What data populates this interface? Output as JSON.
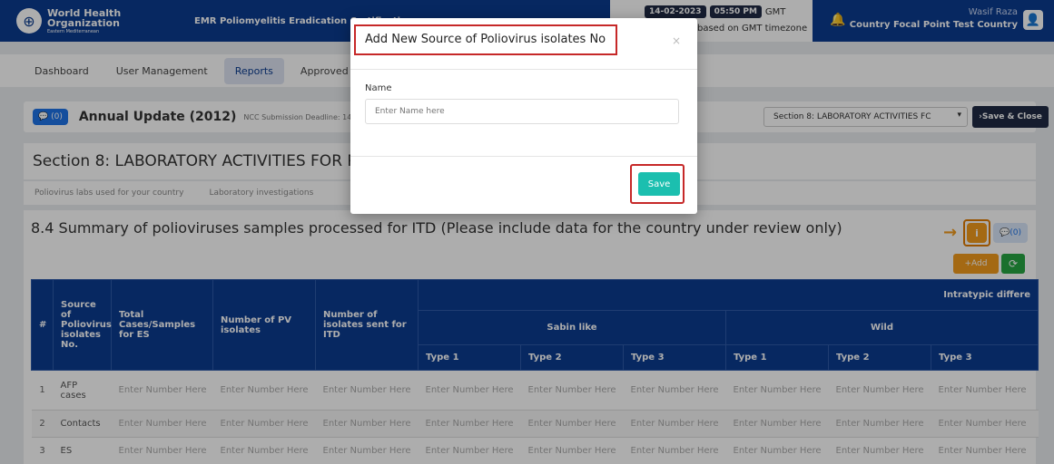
{
  "header": {
    "org_line1": "World Health",
    "org_line2": "Organization",
    "org_line3": "Eastern Mediterranean",
    "app_title": "EMR Poliomyelitis Eradication Certification",
    "date": "14-02-2023",
    "time": "05:50 PM",
    "tz": "GMT",
    "time_note": "based on GMT timezone",
    "user_name": "Wasif Raza",
    "user_role": "Country Focal Point Test Country",
    "icons": {
      "bell": "bell-icon",
      "avatar": "user-icon",
      "logo": "who-logo"
    }
  },
  "nav": {
    "items": [
      {
        "label": "Dashboard"
      },
      {
        "label": "User Management"
      },
      {
        "label": "Reports",
        "active": true
      },
      {
        "label": "Approved R"
      }
    ]
  },
  "annual": {
    "badge": "(0)",
    "title": "Annual Update (2012)",
    "subtitle": "NCC Submission Deadline: 14-02",
    "section_select": "Section 8: LABORATORY ACTIVITIES FC",
    "save_close": "Save & Close"
  },
  "section": {
    "title": "Section 8: LABORATORY ACTIVITIES FOR P",
    "tabs": [
      "Poliovirus labs used for your country",
      "Laboratory investigations"
    ]
  },
  "summary": {
    "title": "8.4 Summary of polioviruses samples processed for ITD (Please include data for the country under review only)",
    "chat_badge": "(0)",
    "add_label": "Add",
    "accent_orange": "#f29b1d",
    "accent_green": "#27a543"
  },
  "table": {
    "headers": {
      "num": "#",
      "source": "Source of Poliovirus isolates No.",
      "total": "Total Cases/Samples for ES",
      "pv": "Number of PV isolates",
      "itd": "Number of isolates sent for ITD",
      "intratypic": "Intratypic differe",
      "sabin": "Sabin like",
      "wild": "Wild",
      "type1": "Type 1",
      "type2": "Type 2",
      "type3": "Type 3"
    },
    "placeholder": "Enter Number Here",
    "rows": [
      {
        "num": "1",
        "source": "AFP cases"
      },
      {
        "num": "2",
        "source": "Contacts"
      },
      {
        "num": "3",
        "source": "ES"
      }
    ]
  },
  "modal": {
    "title": "Add New Source of Poliovirus isolates No",
    "close": "×",
    "field_label": "Name",
    "field_placeholder": "Enter Name here",
    "save": "Save",
    "highlight_color": "#c62828"
  }
}
